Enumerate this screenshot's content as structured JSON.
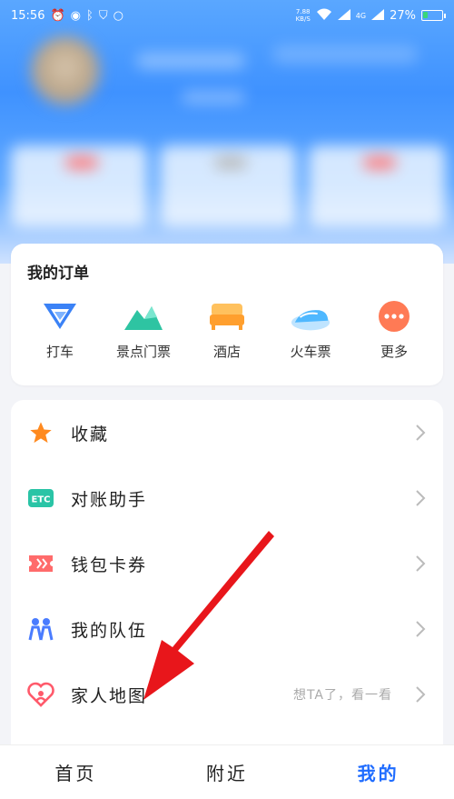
{
  "status_bar": {
    "time": "15:56",
    "speed_top": "7.88",
    "speed_unit": "KB/S",
    "battery": "27%",
    "battery_level": 0.27,
    "network": "4G"
  },
  "orders": {
    "title": "我的订单",
    "items": [
      {
        "label": "打车",
        "icon": "taxi-icon"
      },
      {
        "label": "景点门票",
        "icon": "mountain-icon"
      },
      {
        "label": "酒店",
        "icon": "bed-icon"
      },
      {
        "label": "火车票",
        "icon": "train-icon"
      },
      {
        "label": "更多",
        "icon": "more-icon"
      }
    ]
  },
  "menu": {
    "items": [
      {
        "label": "收藏",
        "icon": "star-icon",
        "hint": ""
      },
      {
        "label": "对账助手",
        "icon": "etc-icon",
        "hint": ""
      },
      {
        "label": "钱包卡券",
        "icon": "ticket-icon",
        "hint": ""
      },
      {
        "label": "我的队伍",
        "icon": "team-icon",
        "hint": ""
      },
      {
        "label": "家人地图",
        "icon": "family-heart-icon",
        "hint": "想TA了，看一看"
      }
    ]
  },
  "etc_text": "ETC",
  "bottom_nav": {
    "tabs": [
      {
        "label": "首页"
      },
      {
        "label": "附近"
      },
      {
        "label": "我的"
      }
    ]
  },
  "colors": {
    "accent": "#1f6cff",
    "star": "#ff8a1f",
    "etc": "#2ac4a6",
    "ticket": "#ff6b6b",
    "team": "#4a7cff",
    "heart": "#ff5a6b",
    "arrow": "#e8161b"
  }
}
